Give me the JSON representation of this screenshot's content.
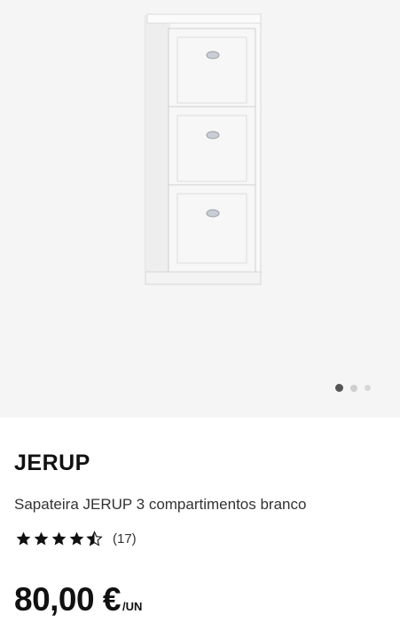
{
  "product": {
    "brand": "JERUP",
    "description": "Sapateira JERUP 3 compartimentos branco",
    "rating": 4.5,
    "rating_max": 5,
    "review_count": "(17)",
    "price": "80,00 €",
    "unit": "/UN"
  },
  "gallery": {
    "image_count": 3,
    "active_index": 0
  },
  "colors": {
    "gallery_bg": "#f5f5f5",
    "star": "#111111",
    "dot_active": "#555555",
    "dot_inactive": "#cfcfcf"
  },
  "icons": {
    "star_full": "star-icon",
    "star_half": "star-half-icon"
  }
}
